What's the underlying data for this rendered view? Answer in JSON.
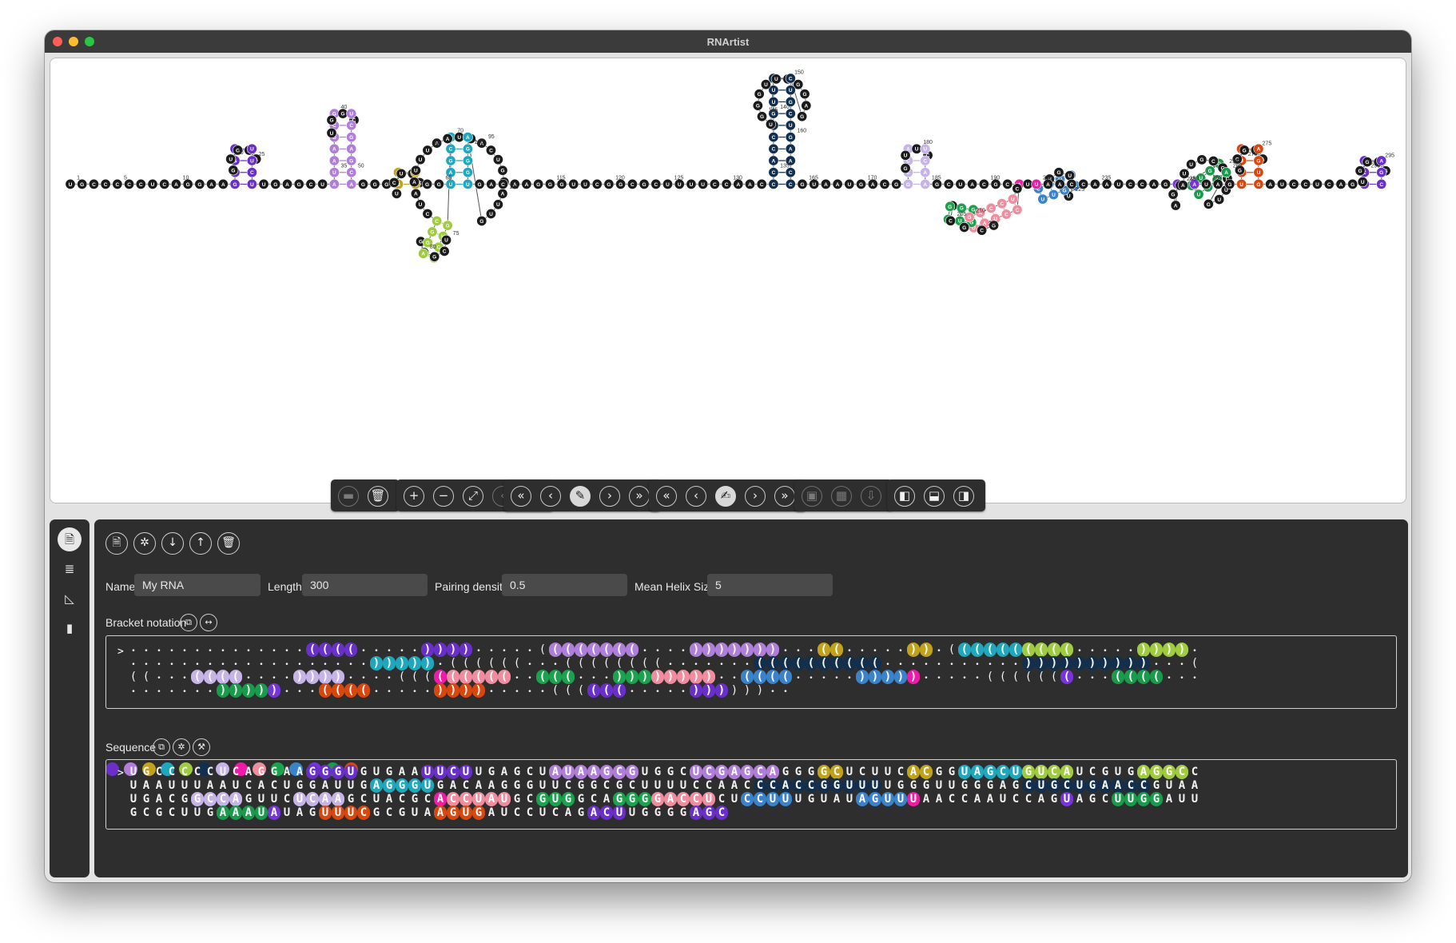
{
  "window": {
    "title": "RNArtist"
  },
  "colors": [
    "#6a2fc9",
    "#b07ed8",
    "#c1a21a",
    "#1fa7bd",
    "#9fcc3f",
    "#122f4e",
    "#c6b3e8",
    "#ef1ba8",
    "#ef8d9e",
    "#1aa24d",
    "#3a82c9",
    "#7834d8",
    "#1a9a4b",
    "#d9470f"
  ],
  "canvas": {
    "bases": "UGCCCCCUCAGGAAGGGUGUGAAUUCUUGAGCUAUAAGCGUGGCUCGAGCAGGGGCUCUUCACGGUAGCUGUCAUCGUGAGGCCUAAUUUAAUCACUGGAUUGAGGGUGACAAGGGUUCGGCGCUUUUCCAACCCACCGGUUUUGGGUUGGGAGCUGCUGAACCGUAAUGACGGCCAGUUCUCAAGCUACGCACCUAUGCGUGGCAGGGGACCUCUCCUUUGUAUAGUUUAACCAAUCCAGUAGCUUGGAUUGCGCUUGAAAUAUAGUUUCGCGUAAGUGAUCCUCAGACUUGGGGAGC",
    "ticks": [
      "1",
      "5",
      "10",
      "20",
      "25",
      "35",
      "40",
      "50",
      "65",
      "70",
      "75",
      "80",
      "90",
      "95",
      "100",
      "105",
      "115",
      "120",
      "125",
      "130",
      "135",
      "140",
      "145",
      "150",
      "160",
      "165",
      "170",
      "180",
      "185",
      "190",
      "200",
      "205",
      "210",
      "225",
      "230",
      "235",
      "245",
      "250",
      "255",
      "260",
      "265",
      "270",
      "275",
      "290",
      "295",
      "300"
    ]
  },
  "toolbar": {
    "groups": [
      {
        "buttons": [
          {
            "icon": "folder-icon",
            "glyph": "▬"
          },
          {
            "icon": "trash-icon",
            "glyph": "🗑"
          }
        ]
      },
      {
        "buttons": [
          {
            "icon": "zoom-in-icon",
            "glyph": "+"
          },
          {
            "icon": "zoom-out-icon",
            "glyph": "−"
          },
          {
            "icon": "fit-icon",
            "glyph": "⤢"
          },
          {
            "icon": "prev-icon",
            "glyph": "‹"
          },
          {
            "icon": "next-icon",
            "glyph": "›"
          }
        ]
      },
      {
        "buttons": [
          {
            "icon": "first-icon",
            "glyph": "«"
          },
          {
            "icon": "back-icon",
            "glyph": "‹"
          },
          {
            "icon": "brush-icon",
            "glyph": "✎"
          },
          {
            "icon": "forward-icon",
            "glyph": "›"
          },
          {
            "icon": "last-icon",
            "glyph": "»"
          }
        ]
      },
      {
        "buttons": [
          {
            "icon": "first-icon",
            "glyph": "«"
          },
          {
            "icon": "back-icon",
            "glyph": "‹"
          },
          {
            "icon": "draw-icon",
            "glyph": "✍"
          },
          {
            "icon": "forward-icon",
            "glyph": "›"
          },
          {
            "icon": "last-icon",
            "glyph": "»"
          }
        ]
      },
      {
        "buttons": [
          {
            "icon": "save-icon",
            "glyph": "▣"
          },
          {
            "icon": "grid-icon",
            "glyph": "▦"
          },
          {
            "icon": "export-icon",
            "glyph": "⇩"
          }
        ]
      },
      {
        "buttons": [
          {
            "icon": "left-panel-icon",
            "glyph": "◧"
          },
          {
            "icon": "bottom-panel-icon",
            "glyph": "⬓"
          },
          {
            "icon": "right-panel-icon",
            "glyph": "◨"
          }
        ]
      }
    ]
  },
  "sidebar": {
    "items": [
      {
        "icon": "document-icon",
        "glyph": "🗎"
      },
      {
        "icon": "database-icon",
        "glyph": "≣"
      },
      {
        "icon": "chart-icon",
        "glyph": "◺"
      },
      {
        "icon": "book-icon",
        "glyph": "▮"
      }
    ]
  },
  "actions": [
    {
      "icon": "new-icon",
      "glyph": "🗎"
    },
    {
      "icon": "settings-icon",
      "glyph": "✲"
    },
    {
      "icon": "down-icon",
      "glyph": "↓"
    },
    {
      "icon": "up-icon",
      "glyph": "↑"
    },
    {
      "icon": "delete-icon",
      "glyph": "🗑"
    }
  ],
  "form": {
    "name_label": "Name",
    "name_value": "My RNA",
    "length_label": "Length",
    "length_value": "300",
    "density_label": "Pairing density",
    "density_value": "0.5",
    "helix_label": "Mean Helix Size",
    "helix_value": "5"
  },
  "bracket": {
    "label": "Bracket notation",
    "prompt": ">",
    "notation": "..............((((.....)))).....((((((((....)))))))...((.....)).((((((((((.....))))....................))))).((((((...((((((((.......((((((((((...........))))))))))...(((...((((....))))....(((((((((..(((...))))))))..((((.....))))).....(((((((...((((..........)))))...((((.....)))).....((((((.....)))))).."
  },
  "sequence": {
    "label": "Sequence",
    "prompt": ">"
  }
}
